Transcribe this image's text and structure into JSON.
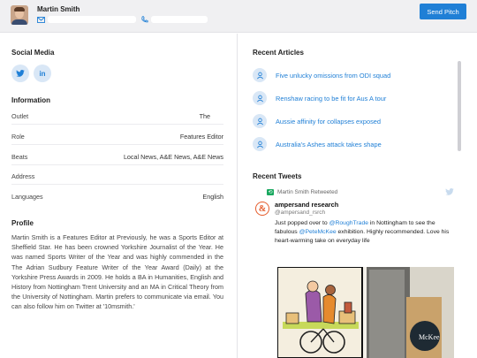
{
  "header": {
    "name": "Martin Smith",
    "pitch_label": "Send Pitch",
    "icons": [
      "envelope-icon",
      "phone-icon"
    ]
  },
  "social": {
    "title": "Social Media",
    "twitter_label": "t",
    "linkedin_label": "in"
  },
  "information": {
    "title": "Information",
    "rows": [
      {
        "label": "Outlet",
        "value": "The"
      },
      {
        "label": "Role",
        "value": "Features Editor"
      },
      {
        "label": "Beats",
        "value": "Local News, A&E News, A&E News"
      },
      {
        "label": "Address",
        "value": ""
      },
      {
        "label": "Languages",
        "value": "English"
      }
    ]
  },
  "profile": {
    "title": "Profile",
    "text": "Martin Smith is a Features Editor at                    Previously, he was a Sports Editor at Sheffield Star. He has been crowned Yorkshire Journalist of the Year. He was named Sports Writer of the Year and was highly commended in the The Adrian Sudbury Feature Writer of the Year Award (Daily) at the Yorkshire Press Awards in 2009. He holds a BA in Humanities, English and History from Nottingham Trent University and an MA in Critical Theory from the University of Nottingham. Martin prefers to communicate via email. You can also follow him on Twitter at '10msmith.'"
  },
  "articles": {
    "title": "Recent Articles",
    "items": [
      "Five unlucky omissions from ODI squad",
      "Renshaw racing to be fit for Aus A tour",
      "Aussie affinity for collapses exposed",
      "Australia's Ashes attack takes shape"
    ]
  },
  "tweets": {
    "title": "Recent Tweets",
    "retweet_line": "Martin Smith Retweeted",
    "author": "ampersand research",
    "handle": "@ampersand_rsrch",
    "avatar_glyph": "&",
    "text_1": "Just popped over to ",
    "mention_1": "@RoughTrade",
    "text_2": " in Nottingham to see the fabulous ",
    "mention_2": "@PeteMcKee",
    "text_3": " exhibition.  Highly recommended.  Love his heart-warming take on everyday life",
    "media_caption": "McKee"
  },
  "colors": {
    "accent": "#1f7fd6",
    "header_bg": "#f0f0f2",
    "retweet_green": "#19a85f",
    "avatar_orange": "#e55b2b"
  }
}
